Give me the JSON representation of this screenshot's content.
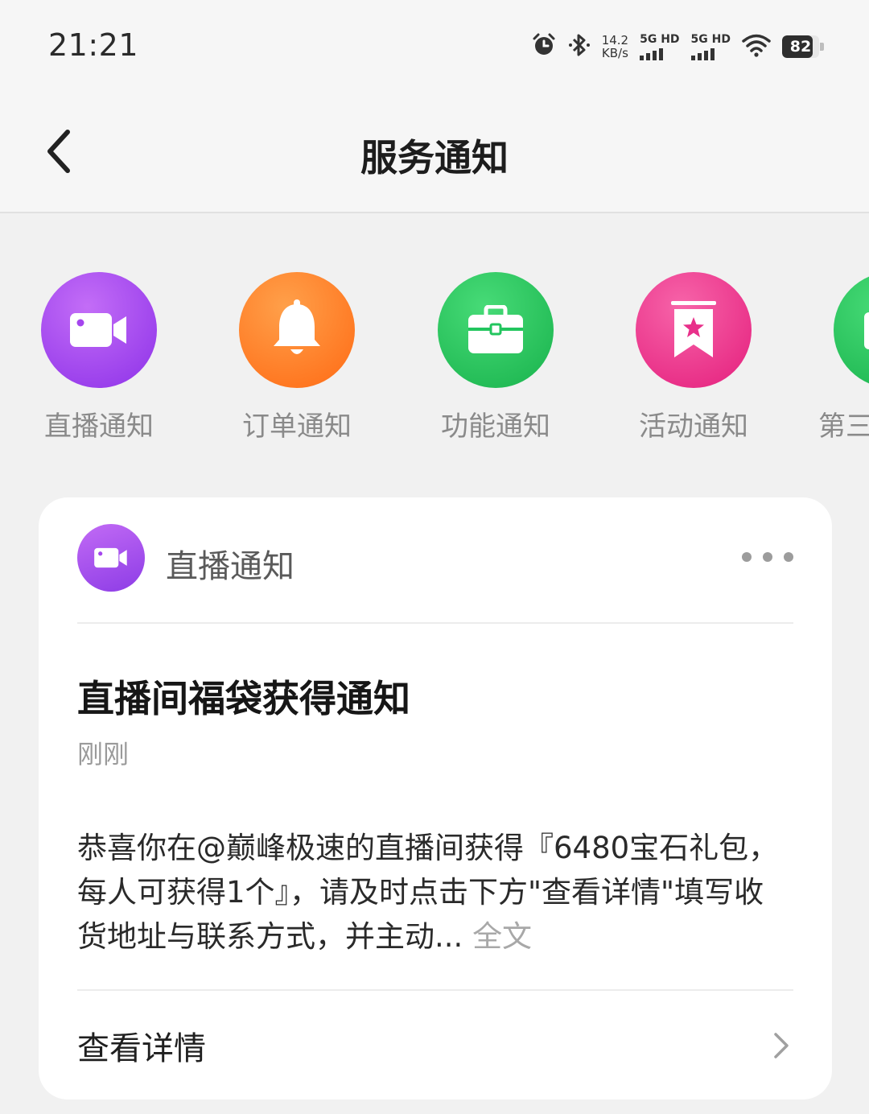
{
  "status_bar": {
    "time": "21:21",
    "net_speed_value": "14.2",
    "net_speed_unit": "KB/s",
    "signal_1_label": "5G HD",
    "signal_2_label": "5G HD",
    "battery_level": "82",
    "battery_fraction": 0.82,
    "icons": [
      "alarm-icon",
      "bluetooth-icon",
      "wifi-icon",
      "battery-icon"
    ]
  },
  "header": {
    "title": "服务通知",
    "back_icon": "chevron-left-icon"
  },
  "categories": [
    {
      "label": "直播通知",
      "icon": "video-camera-icon",
      "color": "#a545ee"
    },
    {
      "label": "订单通知",
      "icon": "bell-icon",
      "color": "#ff7a1f"
    },
    {
      "label": "功能通知",
      "icon": "briefcase-icon",
      "color": "#22c55e"
    },
    {
      "label": "活动通知",
      "icon": "bookmark-star-icon",
      "color": "#ee2f8a"
    },
    {
      "label": "第三",
      "icon": "partial-icon",
      "color": "#22c55e"
    }
  ],
  "card": {
    "source": "直播通知",
    "source_icon": "video-camera-icon",
    "title": "直播间福袋获得通知",
    "time": "刚刚",
    "body": "恭喜你在@巅峰极速的直播间获得『6480宝石礼包，每人可获得1个』，请及时点击下方\"查看详情\"填写收货地址与联系方式，并主动...",
    "expand_label": "全文",
    "detail_label": "查看详情",
    "detail_icon": "chevron-right-icon"
  }
}
